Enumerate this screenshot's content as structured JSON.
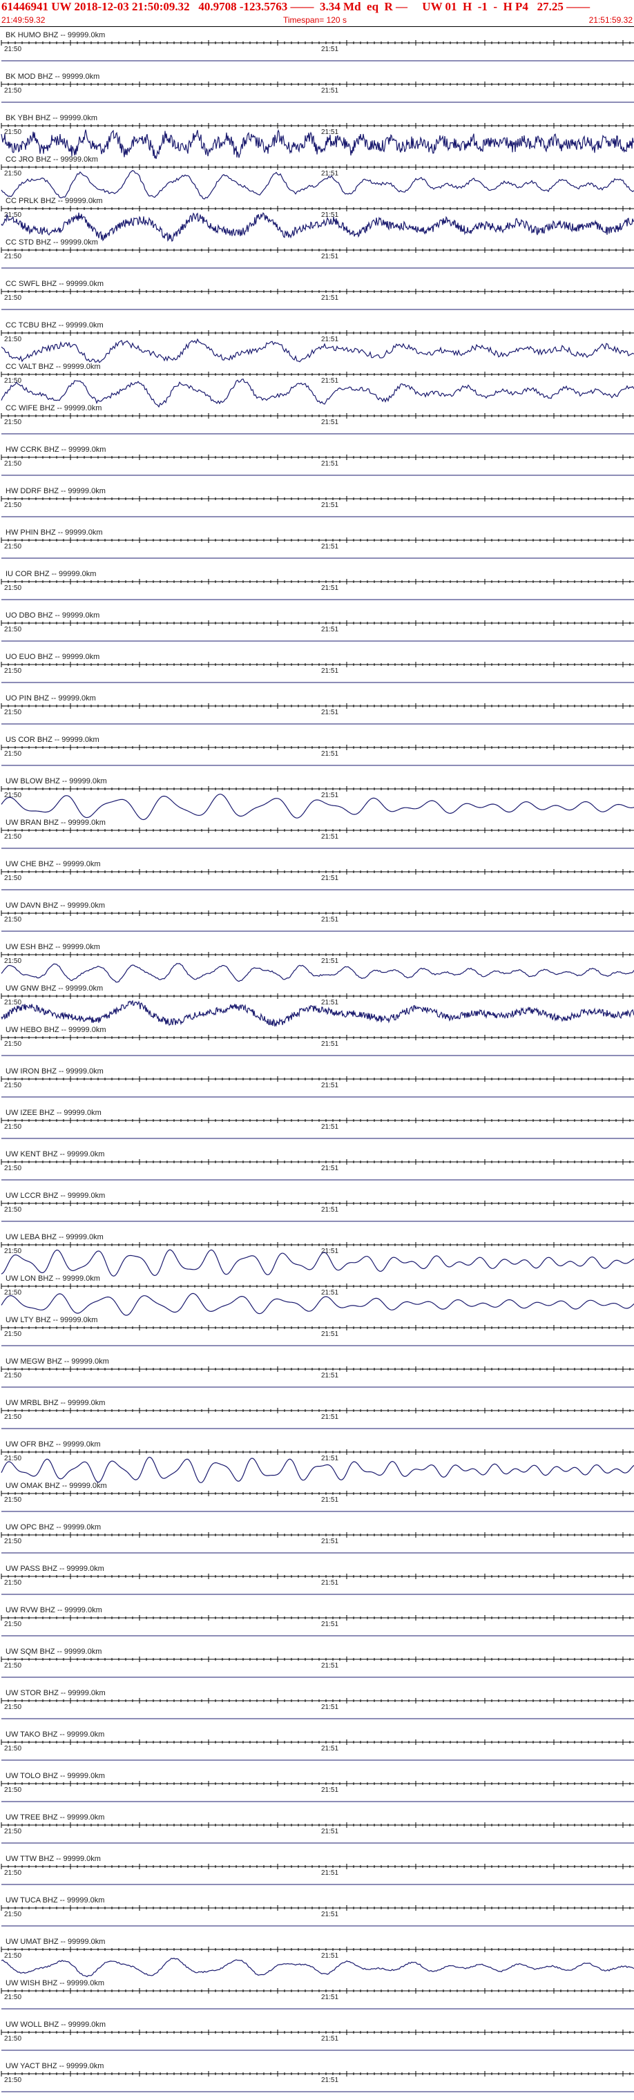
{
  "header": {
    "title": "61446941 UW 2018-12-03 21:50:09.32   40.9708 -123.5763 ——  3.34 Md  eq  R —     UW 01  H  -1  -  H P4   27.25 ——",
    "time_start": "21:49:59.32",
    "timespan": "Timespan= 120 s",
    "time_end": "21:51:59.32"
  },
  "tick_labels": {
    "first": "21:50",
    "second": "21:51"
  },
  "colors": {
    "header_text": "#e00000",
    "trace": "#1a1a6e",
    "axis": "#000000",
    "label": "#222222"
  },
  "stations": [
    {
      "label": "BK HUMO BHZ -- 99999.0km",
      "amp": 0,
      "period": 0,
      "noise": 0
    },
    {
      "label": "BK MOD BHZ -- 99999.0km",
      "amp": 0,
      "period": 0,
      "noise": 0
    },
    {
      "label": "BK YBH BHZ -- 99999.0km",
      "amp": 10,
      "period": 40,
      "noise": 9
    },
    {
      "label": "CC JRO BHZ -- 99999.0km",
      "amp": 15,
      "period": 70,
      "noise": 2
    },
    {
      "label": "CC PRLK BHZ -- 99999.0km",
      "amp": 12,
      "period": 90,
      "noise": 6
    },
    {
      "label": "CC STD BHZ -- 99999.0km",
      "amp": 0,
      "period": 0,
      "noise": 0
    },
    {
      "label": "CC SWFL BHZ -- 99999.0km",
      "amp": 0,
      "period": 0,
      "noise": 0
    },
    {
      "label": "CC TCBU BHZ -- 99999.0km",
      "amp": 12,
      "period": 100,
      "noise": 4
    },
    {
      "label": "CC VALT BHZ -- 99999.0km",
      "amp": 14,
      "period": 80,
      "noise": 3
    },
    {
      "label": "CC WIFE BHZ -- 99999.0km",
      "amp": 0,
      "period": 0,
      "noise": 0
    },
    {
      "label": "HW CCRK BHZ -- 99999.0km",
      "amp": 0,
      "period": 0,
      "noise": 0
    },
    {
      "label": "HW DDRF BHZ -- 99999.0km",
      "amp": 0,
      "period": 0,
      "noise": 0
    },
    {
      "label": "HW PHIN BHZ -- 99999.0km",
      "amp": 0,
      "period": 0,
      "noise": 0
    },
    {
      "label": "IU COR BHZ -- 99999.0km",
      "amp": 0,
      "period": 0,
      "noise": 0
    },
    {
      "label": "UO DBO BHZ -- 99999.0km",
      "amp": 0,
      "period": 0,
      "noise": 0
    },
    {
      "label": "UO EUO BHZ -- 99999.0km",
      "amp": 0,
      "period": 0,
      "noise": 0
    },
    {
      "label": "UO PIN BHZ -- 99999.0km",
      "amp": 0,
      "period": 0,
      "noise": 0
    },
    {
      "label": "US COR BHZ -- 99999.0km",
      "amp": 0,
      "period": 0,
      "noise": 0
    },
    {
      "label": "UW BLOW BHZ -- 99999.0km",
      "amp": 14,
      "period": 75,
      "noise": 0
    },
    {
      "label": "UW BRAN BHZ -- 99999.0km",
      "amp": 0,
      "period": 0,
      "noise": 0
    },
    {
      "label": "UW CHE BHZ -- 99999.0km",
      "amp": 0,
      "period": 0,
      "noise": 0
    },
    {
      "label": "UW DAVN BHZ -- 99999.0km",
      "amp": 0,
      "period": 0,
      "noise": 0
    },
    {
      "label": "UW ESH BHZ -- 99999.0km",
      "amp": 10,
      "period": 60,
      "noise": 1
    },
    {
      "label": "UW GNW BHZ -- 99999.0km",
      "amp": 11,
      "period": 140,
      "noise": 5
    },
    {
      "label": "UW HEBO BHZ -- 99999.0km",
      "amp": 0,
      "period": 0,
      "noise": 0
    },
    {
      "label": "UW IRON BHZ -- 99999.0km",
      "amp": 0,
      "period": 0,
      "noise": 0
    },
    {
      "label": "UW IZEE BHZ -- 99999.0km",
      "amp": 0,
      "period": 0,
      "noise": 0
    },
    {
      "label": "UW KENT BHZ -- 99999.0km",
      "amp": 0,
      "period": 0,
      "noise": 0
    },
    {
      "label": "UW LCCR BHZ -- 99999.0km",
      "amp": 0,
      "period": 0,
      "noise": 0
    },
    {
      "label": "UW LEBA BHZ -- 99999.0km",
      "amp": 15,
      "period": 55,
      "noise": 0
    },
    {
      "label": "UW LON BHZ -- 99999.0km",
      "amp": 12,
      "period": 65,
      "noise": 0
    },
    {
      "label": "UW LTY BHZ -- 99999.0km",
      "amp": 0,
      "period": 0,
      "noise": 0
    },
    {
      "label": "UW MEGW BHZ -- 99999.0km",
      "amp": 0,
      "period": 0,
      "noise": 0
    },
    {
      "label": "UW MRBL BHZ -- 99999.0km",
      "amp": 0,
      "period": 0,
      "noise": 0
    },
    {
      "label": "UW OFR BHZ -- 99999.0km",
      "amp": 14,
      "period": 50,
      "noise": 0
    },
    {
      "label": "UW OMAK BHZ -- 99999.0km",
      "amp": 0,
      "period": 0,
      "noise": 0
    },
    {
      "label": "UW OPC BHZ -- 99999.0km",
      "amp": 0,
      "period": 0,
      "noise": 0
    },
    {
      "label": "UW PASS BHZ -- 99999.0km",
      "amp": 0,
      "period": 0,
      "noise": 0
    },
    {
      "label": "UW RVW BHZ -- 99999.0km",
      "amp": 0,
      "period": 0,
      "noise": 0
    },
    {
      "label": "UW SQM BHZ -- 99999.0km",
      "amp": 0,
      "period": 0,
      "noise": 0
    },
    {
      "label": "UW STOR BHZ -- 99999.0km",
      "amp": 0,
      "period": 0,
      "noise": 0
    },
    {
      "label": "UW TAKO BHZ -- 99999.0km",
      "amp": 0,
      "period": 0,
      "noise": 0
    },
    {
      "label": "UW TOLO BHZ -- 99999.0km",
      "amp": 0,
      "period": 0,
      "noise": 0
    },
    {
      "label": "UW TREE BHZ -- 99999.0km",
      "amp": 0,
      "period": 0,
      "noise": 0
    },
    {
      "label": "UW TTW BHZ -- 99999.0km",
      "amp": 0,
      "period": 0,
      "noise": 0
    },
    {
      "label": "UW TUCA BHZ -- 99999.0km",
      "amp": 0,
      "period": 0,
      "noise": 0
    },
    {
      "label": "UW UMAT BHZ -- 99999.0km",
      "amp": 10,
      "period": 85,
      "noise": 1
    },
    {
      "label": "UW WISH BHZ -- 99999.0km",
      "amp": 0,
      "period": 0,
      "noise": 0
    },
    {
      "label": "UW WOLL BHZ -- 99999.0km",
      "amp": 0,
      "period": 0,
      "noise": 0
    },
    {
      "label": "UW YACT BHZ -- 99999.0km",
      "amp": 0,
      "period": 0,
      "noise": 0
    }
  ]
}
